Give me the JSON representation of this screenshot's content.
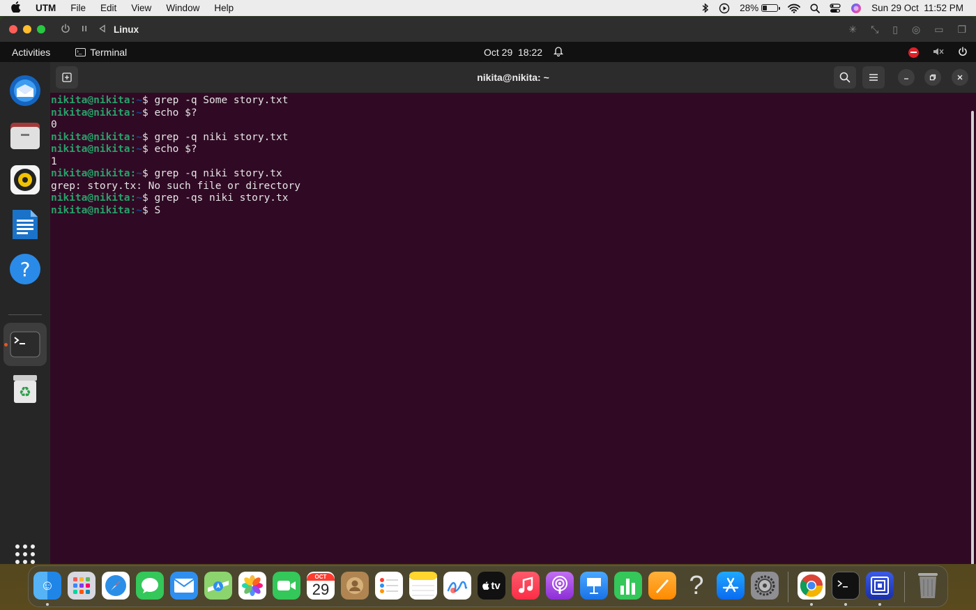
{
  "mac_menubar": {
    "app_name": "UTM",
    "menus": [
      "File",
      "Edit",
      "View",
      "Window",
      "Help"
    ],
    "battery_percent": "28%",
    "battery_level": 0.28,
    "datetime": "Sun 29 Oct  11:52 PM"
  },
  "utm": {
    "vm_name": "Linux"
  },
  "gnome": {
    "activities": "Activities",
    "app_label": "Terminal",
    "clock": "Oct 29  18:22"
  },
  "terminal": {
    "title": "nikita@nikita: ~",
    "prompt_user": "nikita@nikita",
    "prompt_sep": ":",
    "prompt_path": "~",
    "prompt_symbol": "$ ",
    "lines": [
      {
        "type": "cmd",
        "text": "grep -q Some story.txt"
      },
      {
        "type": "cmd",
        "text": "echo $?"
      },
      {
        "type": "out",
        "text": "0"
      },
      {
        "type": "cmd",
        "text": "grep -q niki story.txt"
      },
      {
        "type": "cmd",
        "text": "echo $?"
      },
      {
        "type": "out",
        "text": "1"
      },
      {
        "type": "cmd",
        "text": "grep -q niki story.tx"
      },
      {
        "type": "out",
        "text": "grep: story.tx: No such file or directory"
      },
      {
        "type": "cmd",
        "text": "grep -qs niki story.tx"
      },
      {
        "type": "cmd",
        "text": "S"
      }
    ]
  },
  "ubuntu_dock": {
    "items": [
      "thunderbird-icon",
      "files-icon",
      "rhythmbox-icon",
      "writer-icon",
      "help-icon",
      "terminal-icon",
      "trash-icon",
      "app-grid-icon"
    ]
  },
  "mac_dock": {
    "calendar_month": "OCT",
    "calendar_day": "29",
    "tv_label": "tv"
  }
}
